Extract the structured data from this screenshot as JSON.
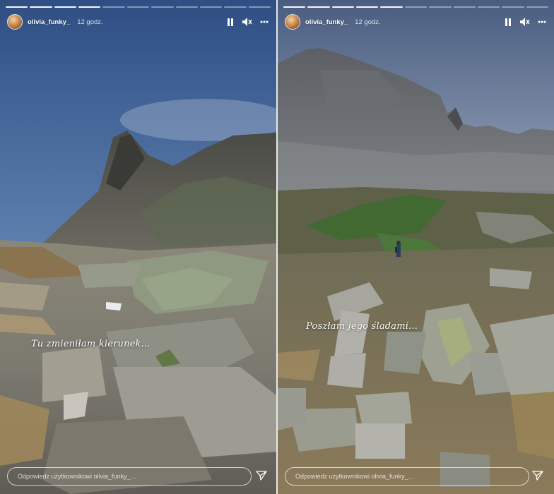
{
  "stories": [
    {
      "username": "olivia_funky_",
      "time": "12 godz.",
      "caption": "Tu zmieniłam kierunek...",
      "reply_placeholder": "Odpowiedz użytkownikowi olivia_funky_..."
    },
    {
      "username": "olivia_funky_",
      "time": "12 godz.",
      "caption": "Poszłam jego śladami...",
      "reply_placeholder": "Odpowiedz użytkownikowi olivia_funky_..."
    }
  ],
  "icons": {
    "pause": "pause-icon",
    "mute": "speaker-muted-icon",
    "more": "more-dots-icon",
    "send": "paper-plane-icon"
  }
}
